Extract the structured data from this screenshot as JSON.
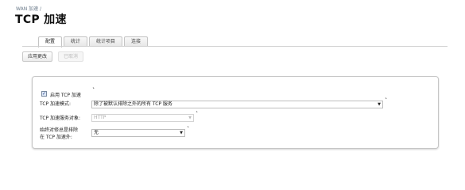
{
  "breadcrumb": "WAN 加速 /",
  "page_title": "TCP 加速",
  "tabs": [
    "配置",
    "统计",
    "统计项目",
    "连接"
  ],
  "toolbar": {
    "apply_label": "应用更改",
    "cancel_label": "已取消"
  },
  "form": {
    "enable_label": "启用 TCP 加速",
    "enable_checked": true,
    "mode_label": "TCP 加速模式:",
    "mode_value": "除了被默认排除之外的所有 TCP 服务",
    "service_label": "TCP 加速服务对象:",
    "service_value": "HTTP",
    "exclude_label_line1": "始终对修总是排除",
    "exclude_label_line2": "在 TCP 加速外:",
    "exclude_value": "无"
  },
  "icons": {
    "dropdown": "chevron-down-icon",
    "check": "checkmark-icon"
  },
  "colors": {
    "tab_border": "#c4c4c4",
    "panel_border": "#c6c6c6",
    "checkbox_fill": "#dde8f6"
  }
}
